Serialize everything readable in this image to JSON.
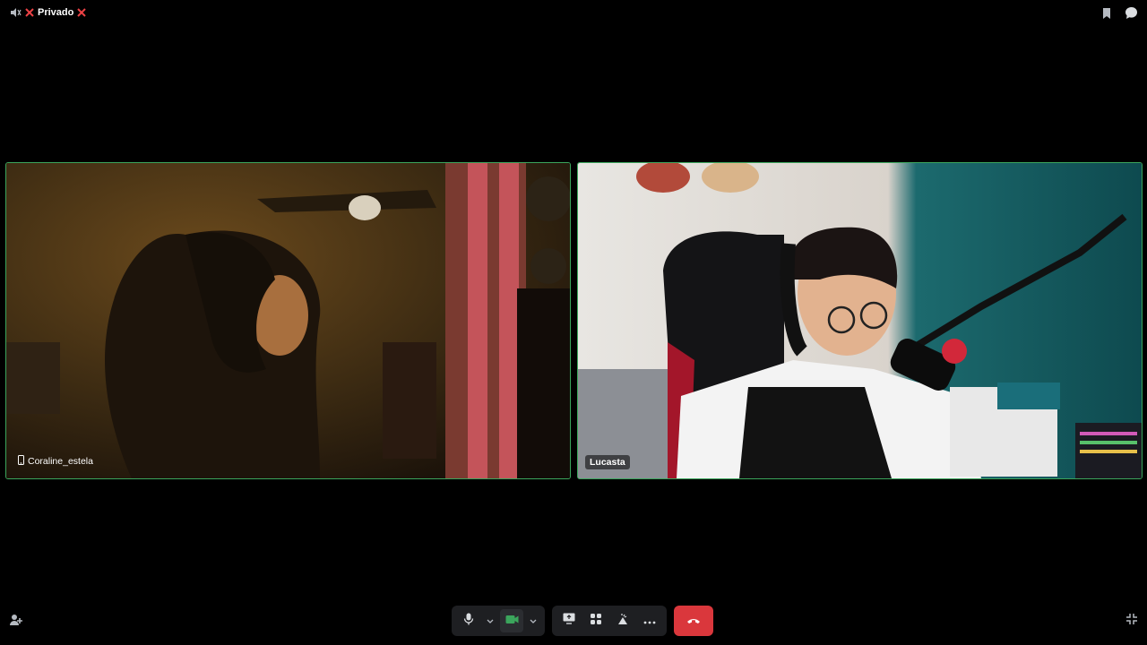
{
  "header": {
    "channel_name": "Privado"
  },
  "participants": [
    {
      "name": "Coraline_estela",
      "device": "mobile"
    },
    {
      "name": "Lucasta"
    }
  ],
  "icons": {
    "speaker": "speaker-muted-icon",
    "close": "close-x-icon",
    "bookmark": "bookmark-icon",
    "chat": "chat-bubble-icon",
    "mic": "microphone-icon",
    "camera": "camera-icon",
    "share": "screen-share-icon",
    "activity": "activities-icon",
    "soundboard": "soundboard-icon",
    "more": "more-dots-icon",
    "hangup": "hang-up-icon",
    "invite": "add-friend-icon",
    "fullscreen": "exit-fullscreen-icon"
  },
  "colors": {
    "accent_border": "#3ba55c",
    "hangup": "#da373c",
    "camera_on": "#3ba55c",
    "close": "#ed4245"
  }
}
